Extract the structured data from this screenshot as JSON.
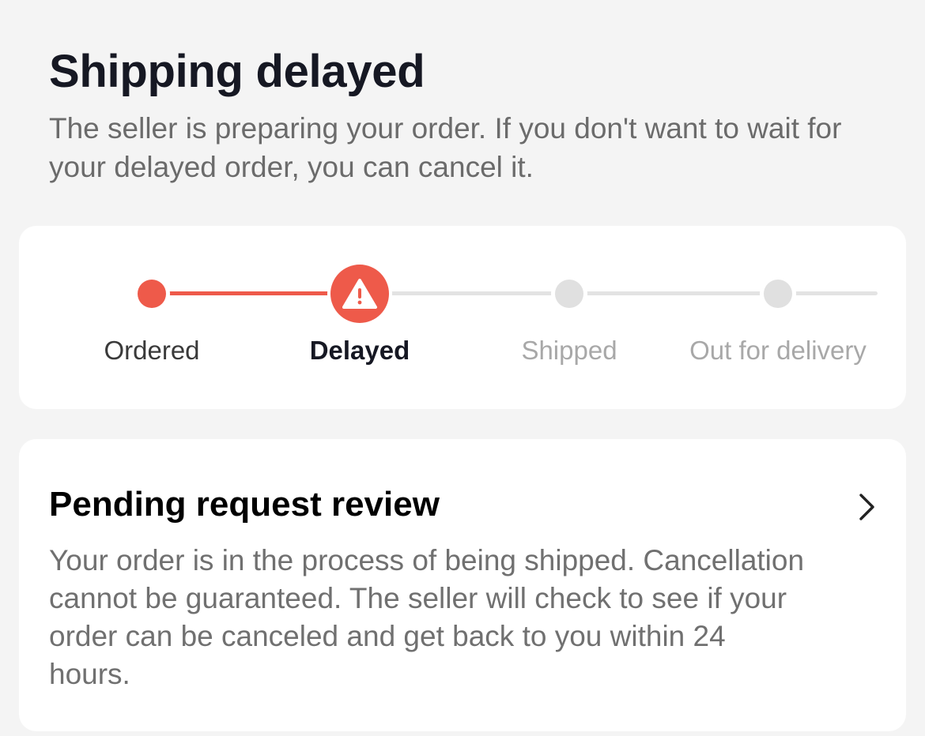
{
  "page": {
    "title": "Shipping delayed",
    "subtitle": "The seller is preparing your order. If you don't want to wait for your delayed order, you can cancel it."
  },
  "progress": {
    "steps": [
      {
        "label": "Ordered",
        "state": "complete"
      },
      {
        "label": "Delayed",
        "state": "current-warning"
      },
      {
        "label": "Shipped",
        "state": "pending"
      },
      {
        "label": "Out for delivery",
        "state": "pending"
      }
    ],
    "icons": {
      "delayed": "warning-triangle-icon"
    }
  },
  "request": {
    "title": "Pending request review",
    "body": "Your order is in the process of being shipped. Cancellation cannot be guaranteed. The seller will check to see if your order can be canceled and get back to you within 24 hours.",
    "icon": "chevron-right-icon"
  },
  "colors": {
    "accent": "#ee5a4a",
    "inactive": "#e0e0e0",
    "label_done": "#3a3a3a",
    "label_current": "#161823",
    "label_pending": "#a8a8a8",
    "background": "#f4f4f4",
    "card": "#ffffff"
  }
}
